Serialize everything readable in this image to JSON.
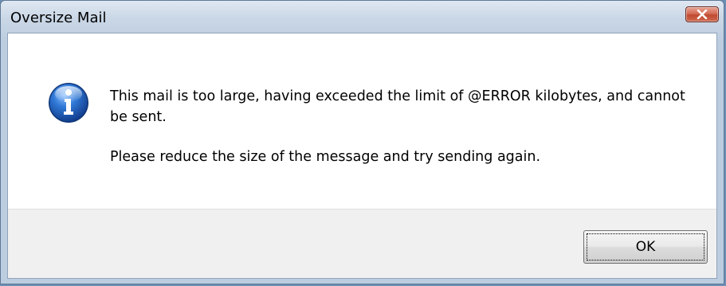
{
  "window": {
    "title": "Oversize Mail"
  },
  "message": {
    "line1": "This mail is too large, having exceeded the limit of @ERROR kilobytes, and cannot be sent.",
    "line2": "Please reduce the size of the message and try sending again."
  },
  "buttons": {
    "ok_label": "OK"
  },
  "icons": {
    "message_icon": "information-icon",
    "close": "close-icon"
  },
  "colors": {
    "titlebar": "#cad7e6",
    "close_button": "#c8533a",
    "info_icon": "#1f5fb8",
    "footer": "#f0f0f0"
  }
}
